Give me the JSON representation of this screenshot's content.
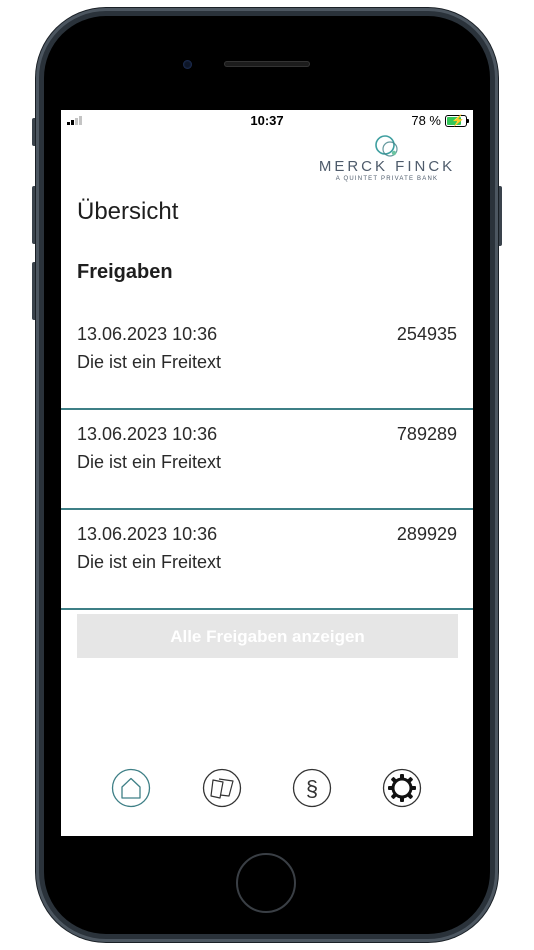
{
  "status_bar": {
    "time": "10:37",
    "battery_percent": "78 %",
    "battery_level": 0.78,
    "charging": true
  },
  "logo": {
    "name": "MERCK FINCK",
    "tagline": "A QUINTET PRIVATE BANK"
  },
  "page": {
    "title": "Übersicht",
    "section_title": "Freigaben"
  },
  "approvals": [
    {
      "datetime": "13.06.2023 10:36",
      "code": "254935",
      "text": "Die ist ein Freitext"
    },
    {
      "datetime": "13.06.2023 10:36",
      "code": "789289",
      "text": "Die ist ein Freitext"
    },
    {
      "datetime": "13.06.2023 10:36",
      "code": "289929",
      "text": "Die ist ein Freitext"
    }
  ],
  "show_all_button": {
    "label": "Alle Freigaben anzeigen",
    "enabled": false
  },
  "tab_bar": {
    "tabs": [
      {
        "icon": "home-icon",
        "active": true
      },
      {
        "icon": "documents-icon",
        "active": false
      },
      {
        "icon": "paragraph-icon",
        "active": false
      },
      {
        "icon": "settings-gear-icon",
        "active": false
      }
    ]
  },
  "colors": {
    "accent": "#3e7f86",
    "logo_text": "#4e5b6b",
    "button_disabled_bg": "#e6e6e6",
    "battery_green": "#34c759"
  }
}
